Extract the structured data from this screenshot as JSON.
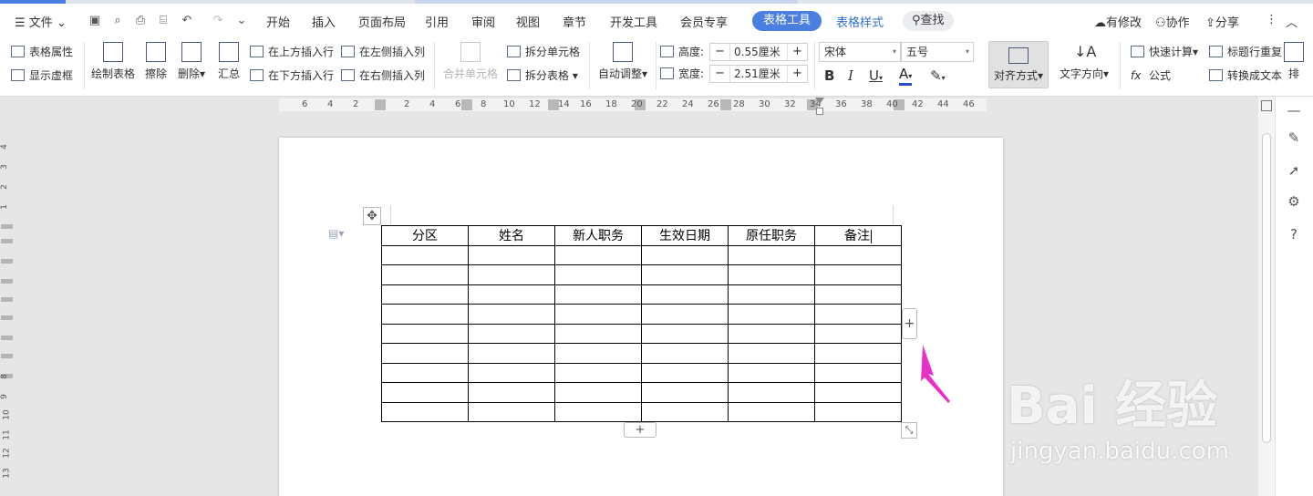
{
  "menu": {
    "file": "文件",
    "tabs": [
      "开始",
      "插入",
      "页面布局",
      "引用",
      "审阅",
      "视图",
      "章节",
      "开发工具",
      "会员专享",
      "表格工具",
      "表格样式"
    ],
    "search": "查找",
    "changes": "有修改",
    "collab": "协作",
    "share": "分享"
  },
  "ribbon": {
    "table_props": "表格属性",
    "show_gridlines": "显示虚框",
    "draw_table": "绘制表格",
    "erase": "擦除",
    "delete": "删除",
    "summary": "汇总",
    "insert_above": "在上方插入行",
    "insert_below": "在下方插入行",
    "insert_left": "在左侧插入列",
    "insert_right": "在右侧插入列",
    "merge_cells": "合并单元格",
    "split_cells": "拆分单元格",
    "split_table": "拆分表格",
    "auto_fit": "自动调整",
    "height_label": "高度:",
    "height_value": "0.55厘米",
    "width_label": "宽度:",
    "width_value": "2.51厘米",
    "font_name": "宋体",
    "font_size": "五号",
    "alignment": "对齐方式",
    "text_direction": "文字方向",
    "quick_calc": "快速计算",
    "formula": "公式",
    "repeat_header": "标题行重复",
    "convert_text": "转换成文本",
    "sort_partial": "排"
  },
  "ruler": {
    "ticks": [
      "6",
      "4",
      "2",
      "2",
      "4",
      "6",
      "8",
      "10",
      "12",
      "14",
      "16",
      "18",
      "20",
      "22",
      "24",
      "26",
      "28",
      "30",
      "32",
      "34",
      "36",
      "38",
      "40",
      "42",
      "44",
      "46"
    ],
    "vticks": [
      "4",
      "3",
      "2",
      "1",
      "8",
      "9",
      "10",
      "11",
      "12",
      "13"
    ]
  },
  "table": {
    "headers": [
      "分区",
      "姓名",
      "新人职务",
      "生效日期",
      "原任职务",
      "备注"
    ],
    "empty_rows": 9
  },
  "controls": {
    "move_handle": "✥",
    "add_column": "+",
    "add_row": "+",
    "resize": "⤡"
  },
  "watermark": {
    "main": "Bai  经验",
    "sub": "jingyan.baidu.com"
  },
  "colors": {
    "accent": "#4a7ee0",
    "arrow": "#e830c8"
  }
}
